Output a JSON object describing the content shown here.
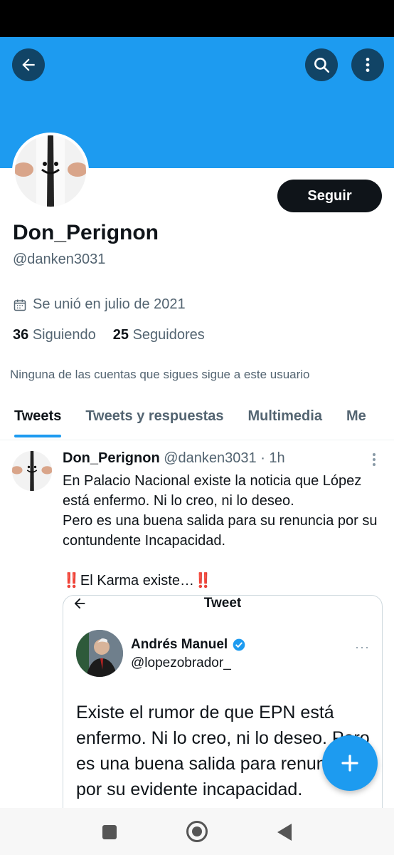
{
  "profile": {
    "display_name": "Don_Perignon",
    "handle": "@danken3031",
    "joined": "Se unió en julio de 2021",
    "following_count": "36",
    "following_label": "Siguiendo",
    "followers_count": "25",
    "followers_label": "Seguidores",
    "notice": "Ninguna de las cuentas que sigues sigue a este usuario",
    "follow_label": "Seguir"
  },
  "header": {
    "back_icon": "arrow-left-icon",
    "search_icon": "search-icon",
    "more_icon": "more-vertical-icon"
  },
  "tabs": [
    {
      "label": "Tweets",
      "active": true
    },
    {
      "label": "Tweets y respuestas",
      "active": false
    },
    {
      "label": "Multimedia",
      "active": false
    },
    {
      "label": "Me",
      "active": false
    }
  ],
  "tweet": {
    "author": "Don_Perignon",
    "handle": "@danken3031",
    "time": "· 1h",
    "line1": "En Palacio Nacional existe la noticia que López está enfermo. Ni lo creo, ni lo deseo.",
    "line2": "Pero es una buena salida para su renuncia por su contundente Incapacidad.",
    "karma_bang": "‼️",
    "karma_text": "El Karma existe…",
    "quote": {
      "title": "Tweet",
      "author": "Andrés Manuel",
      "handle": "@lopezobrador_",
      "dots": "···",
      "text": "Existe el rumor de que EPN está enfermo. Ni lo creo, ni lo deseo. Pero es una buena salida para renuncia por su evidente incapacidad."
    }
  },
  "colors": {
    "accent": "#1d9bf0",
    "text": "#0f1419",
    "muted": "#536471"
  }
}
